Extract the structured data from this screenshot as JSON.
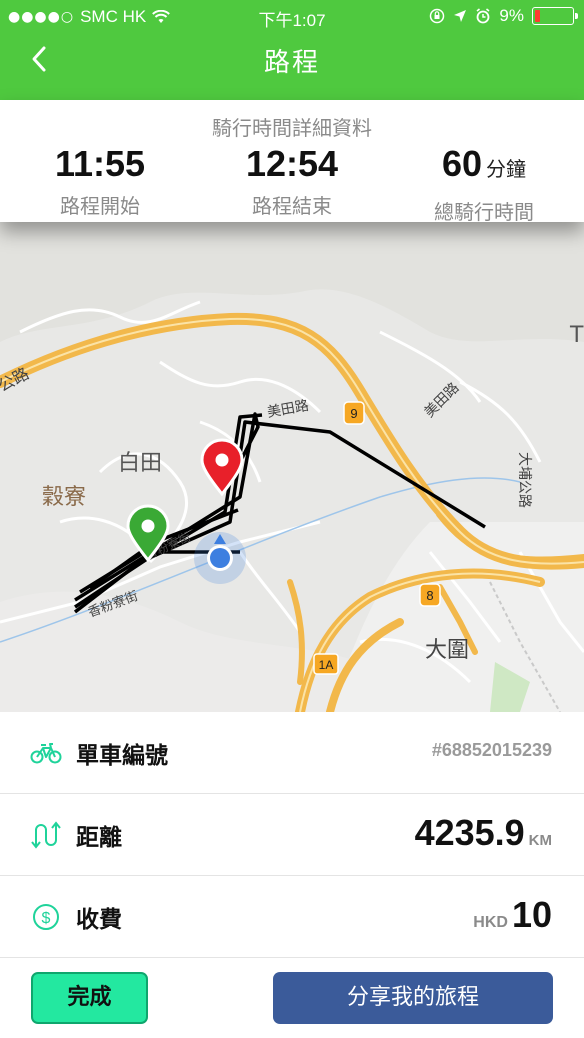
{
  "status_bar": {
    "signal": "●●●●○",
    "carrier": "SMC HK",
    "time": "下午1:07",
    "battery": "9%"
  },
  "nav": {
    "title": "路程"
  },
  "summary": {
    "title": "騎行時間詳細資料",
    "start_time": "11:55",
    "start_label": "路程開始",
    "end_time": "12:54",
    "end_label": "路程結束",
    "duration_value": "60",
    "duration_unit": "分鐘",
    "duration_label": "總騎行時間"
  },
  "map": {
    "labels": [
      "白田",
      "穀寮",
      "美田路",
      "美田路",
      "大圍",
      "大埔公路",
      "香粉寮街",
      "香粉寮街",
      "9",
      "8",
      "1A",
      "T"
    ],
    "road_label_partial": "公路",
    "route_color": "#000000",
    "start_marker_color": "#3aa935",
    "end_marker_color": "#e8202a"
  },
  "details": {
    "bike": {
      "label": "單車編號",
      "value": "#68852015239"
    },
    "distance": {
      "label": "距離",
      "value": "4235.9",
      "unit": "KM"
    },
    "fee": {
      "label": "收費",
      "currency": "HKD",
      "value": "10"
    }
  },
  "buttons": {
    "done": "完成",
    "share": "分享我的旅程"
  },
  "colors": {
    "header": "#4fc93f",
    "done_button": "#23e8a0",
    "share_button": "#3b5b9a",
    "icon_accent": "#1fd39a"
  }
}
